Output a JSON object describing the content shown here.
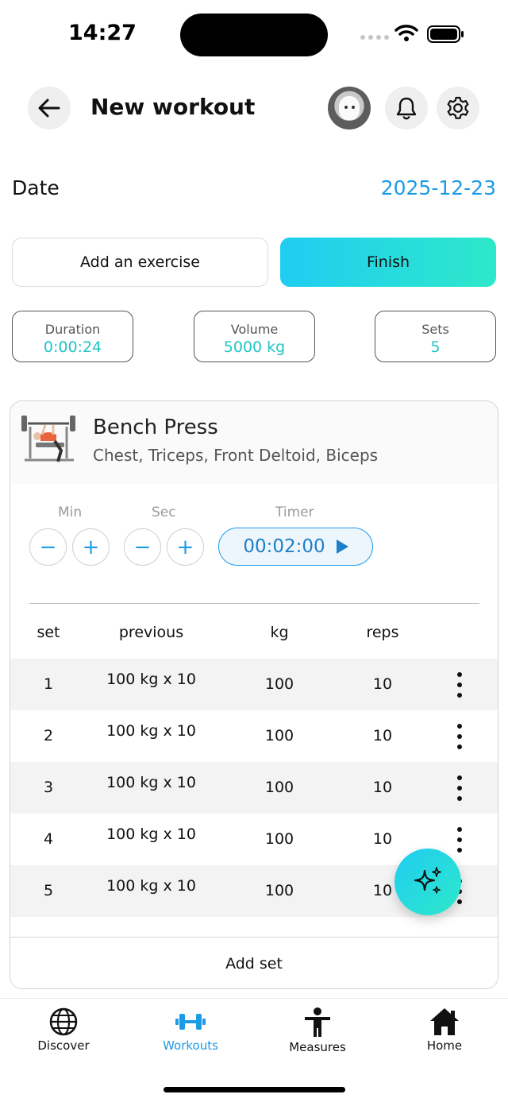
{
  "status": {
    "time": "14:27"
  },
  "header": {
    "title": "New workout"
  },
  "date": {
    "label": "Date",
    "value": "2025-12-23"
  },
  "actions": {
    "add_exercise": "Add an exercise",
    "finish": "Finish"
  },
  "stats": [
    {
      "label": "Duration",
      "value": "0:00:24"
    },
    {
      "label": "Volume",
      "value": "5000 kg"
    },
    {
      "label": "Sets",
      "value": "5"
    }
  ],
  "exercise": {
    "name": "Bench Press",
    "muscles": "Chest, Triceps, Front Deltoid, Biceps",
    "timer": {
      "min_label": "Min",
      "sec_label": "Sec",
      "timer_label": "Timer",
      "value": "00:02:00",
      "minus": "−",
      "plus": "+"
    },
    "columns": {
      "set": "set",
      "previous": "previous",
      "kg": "kg",
      "reps": "reps"
    },
    "sets": [
      {
        "set": "1",
        "previous": "100 kg x 10",
        "kg": "100",
        "reps": "10"
      },
      {
        "set": "2",
        "previous": "100 kg x 10",
        "kg": "100",
        "reps": "10"
      },
      {
        "set": "3",
        "previous": "100 kg x 10",
        "kg": "100",
        "reps": "10"
      },
      {
        "set": "4",
        "previous": "100 kg x 10",
        "kg": "100",
        "reps": "10"
      },
      {
        "set": "5",
        "previous": "100 kg x 10",
        "kg": "100",
        "reps": "10"
      }
    ],
    "add_set": "Add set"
  },
  "tabs": [
    {
      "label": "Discover",
      "icon": "globe-icon",
      "active": false
    },
    {
      "label": "Workouts",
      "icon": "dumbbell-icon",
      "active": true
    },
    {
      "label": "Measures",
      "icon": "person-icon",
      "active": false
    },
    {
      "label": "Home",
      "icon": "home-icon",
      "active": false
    }
  ],
  "colors": {
    "accent": "#1c9be6",
    "teal": "#20c4c8",
    "gradient_start": "#1fcdf2",
    "gradient_end": "#2ee8c9"
  }
}
